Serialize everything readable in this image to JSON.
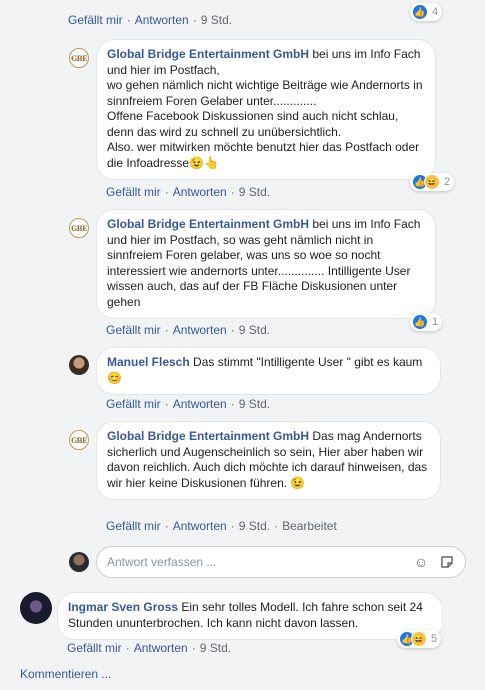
{
  "top_meta": {
    "like": "Gefällt mir",
    "reply": "Antworten",
    "time": "9 Std.",
    "reaction_count": "4"
  },
  "comments": [
    {
      "author": "Global Bridge Entertainment GmbH",
      "avatar_text": "GBE",
      "text": " bei uns im Info Fach und hier im Postfach,\nwo gehen nämlich nicht wichtige Beiträge wie Andernorts in sinnfreiem Foren Gelaber unter.............\nOffene Facebook Diskussionen sind auch nicht schlau, denn das wird zu schnell zu unübersichtlich.\nAlso. wer mitwirken möchte benutzt hier das Postfach oder die Infoadresse😉👆",
      "like": "Gefällt mir",
      "reply": "Antworten",
      "time": "9 Std.",
      "reaction_count": "2"
    },
    {
      "author": "Global Bridge Entertainment GmbH",
      "avatar_text": "GBE",
      "text": " bei uns im Info Fach und hier im Postfach, so was geht nämlich nicht in sinnfreiem Foren gelaber, was uns so woe so nocht interessiert wie andernorts unter.............. Intilligente User wissen auch, das auf der FB Fläche Diskusionen unter gehen",
      "like": "Gefällt mir",
      "reply": "Antworten",
      "time": "9 Std.",
      "reaction_count": "1"
    },
    {
      "author": "Manuel Flesch",
      "text": " Das stimmt \"Intilligente User \" gibt es kaum 😊",
      "like": "Gefällt mir",
      "reply": "Antworten",
      "time": "9 Std."
    },
    {
      "author": "Global Bridge Entertainment GmbH",
      "avatar_text": "GBE",
      "text": " Das mag Andernorts sicherlich und Augenscheinlich so sein, Hier aber haben wir davon reichlich. Auch dich möchte ich darauf hinweisen, das wir hier keine Diskusionen führen. 😉",
      "like": "Gefällt mir",
      "reply": "Antworten",
      "time": "9 Std.",
      "edited": "Bearbeitet"
    }
  ],
  "reply_input": {
    "placeholder": "Antwort verfassen ..."
  },
  "top_comment": {
    "author": "Ingmar Sven Gross",
    "text": " Ein sehr tolles Modell. Ich fahre schon seit 24 Stunden ununterbrochen. Ich kann nicht davon lassen.",
    "like": "Gefällt mir",
    "reply": "Antworten",
    "time": "9 Std.",
    "reaction_count": "5"
  },
  "more_comments": "Kommentieren ...",
  "colors": {
    "link": "#385898",
    "like_blue": "#1877f2",
    "haha_yellow": "#f7c545"
  },
  "icons": [
    "like-icon",
    "haha-icon",
    "emoji-icon",
    "sticker-icon"
  ]
}
